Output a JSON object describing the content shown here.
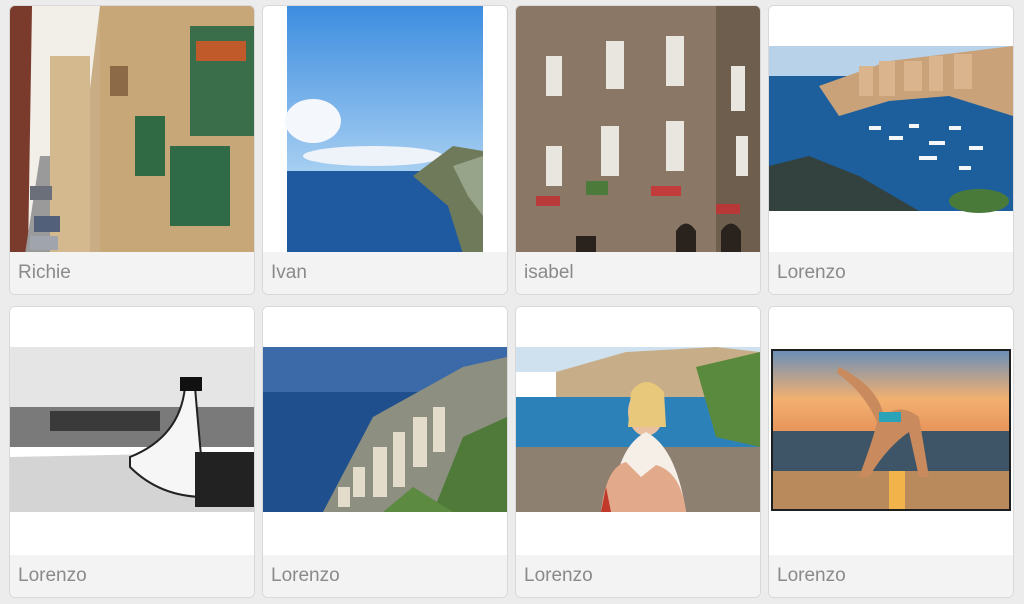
{
  "gallery": {
    "items": [
      {
        "author": "Richie",
        "photo": "street-balconies-photo"
      },
      {
        "author": "Ivan",
        "photo": "sea-coast-photo"
      },
      {
        "author": "isabel",
        "photo": "stone-building-photo"
      },
      {
        "author": "Lorenzo",
        "photo": "harbor-marina-photo"
      },
      {
        "author": "Lorenzo",
        "photo": "bw-legs-photo"
      },
      {
        "author": "Lorenzo",
        "photo": "monaco-aerial-photo"
      },
      {
        "author": "Lorenzo",
        "photo": "woman-hands-harbor-photo"
      },
      {
        "author": "Lorenzo",
        "photo": "yoga-beach-sunset-photo"
      }
    ]
  },
  "colors": {
    "caption_text": "#8a8a8a",
    "caption_bg": "#f3f3f3",
    "page_bg": "#ececec"
  }
}
